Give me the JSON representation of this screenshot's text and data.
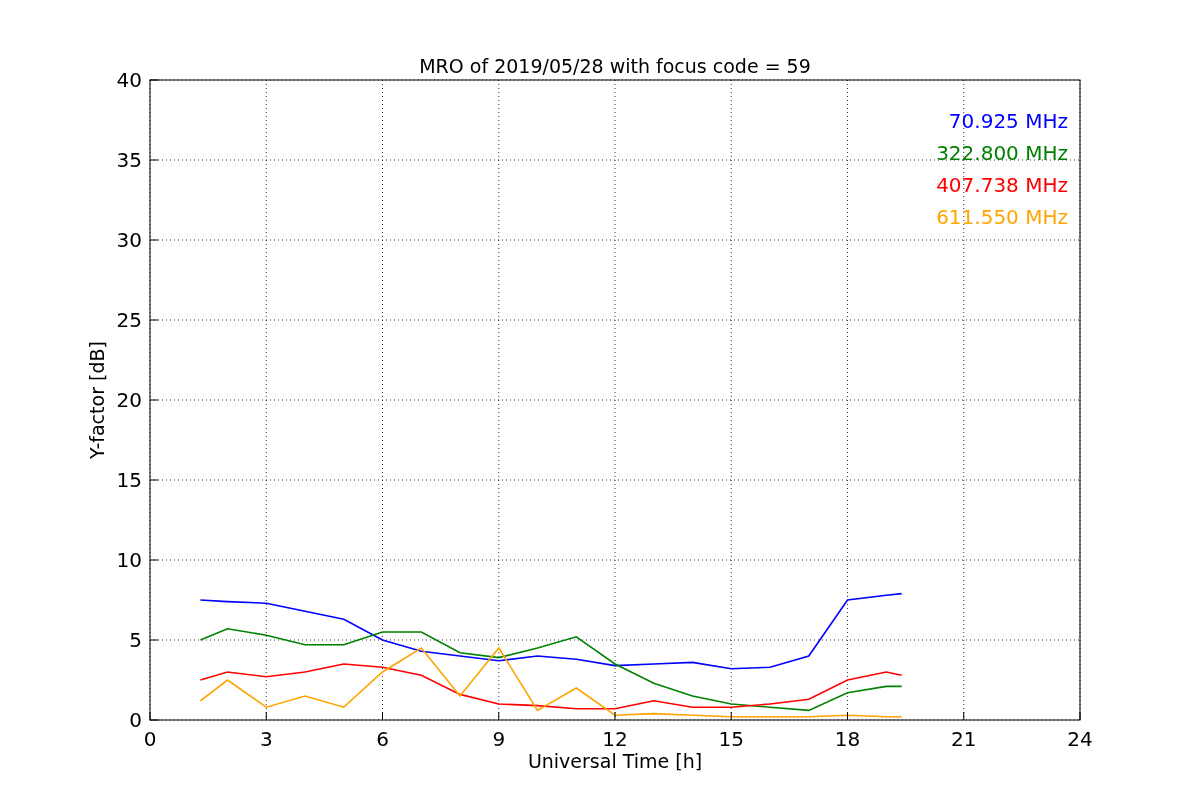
{
  "figure": {
    "chart_data": {
      "type": "line",
      "title": "MRO of 2019/05/28 with focus code = 59",
      "xlabel": "Universal Time [h]",
      "ylabel": "Y-factor [dB]",
      "x": [
        1.3,
        2,
        3,
        4,
        5,
        6,
        7,
        8,
        9,
        10,
        11,
        12,
        13,
        14,
        15,
        16,
        17,
        18,
        19,
        19.4
      ],
      "series": [
        {
          "name": "70.925 MHz",
          "color": "#0000ff",
          "values": [
            7.5,
            7.4,
            7.3,
            6.8,
            6.3,
            5.0,
            4.3,
            4.0,
            3.7,
            4.0,
            3.8,
            3.4,
            3.5,
            3.6,
            3.2,
            3.3,
            4.0,
            7.5,
            7.8,
            7.9
          ]
        },
        {
          "name": "322.800 MHz",
          "color": "#008000",
          "values": [
            5.0,
            5.7,
            5.3,
            4.7,
            4.7,
            5.5,
            5.5,
            4.2,
            3.9,
            4.5,
            5.2,
            3.5,
            2.3,
            1.5,
            1.0,
            0.8,
            0.6,
            1.7,
            2.1,
            2.1
          ]
        },
        {
          "name": "407.738 MHz",
          "color": "#ff0000",
          "values": [
            2.5,
            3.0,
            2.7,
            3.0,
            3.5,
            3.3,
            2.8,
            1.6,
            1.0,
            0.9,
            0.7,
            0.7,
            1.2,
            0.8,
            0.8,
            1.0,
            1.3,
            2.5,
            3.0,
            2.8
          ]
        },
        {
          "name": "611.550 MHz",
          "color": "#ffa500",
          "values": [
            1.2,
            2.5,
            0.8,
            1.5,
            0.8,
            3.0,
            4.5,
            1.5,
            4.5,
            0.6,
            2.0,
            0.3,
            0.4,
            0.3,
            0.2,
            0.2,
            0.2,
            0.3,
            0.2,
            0.2
          ]
        }
      ],
      "xlim": [
        0,
        24
      ],
      "ylim": [
        0,
        40
      ],
      "xticks": [
        0,
        3,
        6,
        9,
        12,
        15,
        18,
        21,
        24
      ],
      "yticks": [
        0,
        5,
        10,
        15,
        20,
        25,
        30,
        35,
        40
      ],
      "grid": true
    }
  }
}
